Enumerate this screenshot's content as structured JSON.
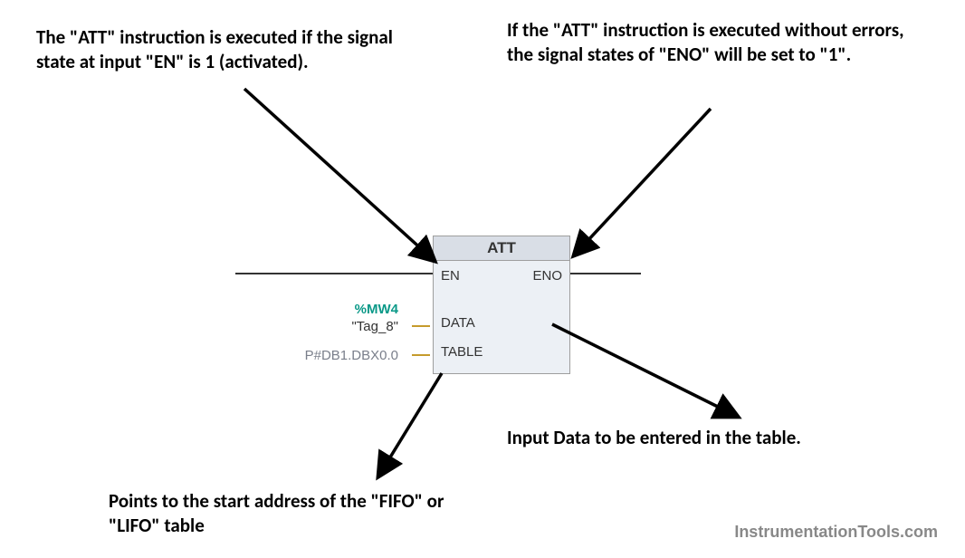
{
  "annotations": {
    "en_text": "The \"ATT\" instruction is executed if the signal state at input \"EN\" is 1 (activated).",
    "eno_text": "If the \"ATT\" instruction is executed without errors, the signal states of \"ENO\" will be set to \"1\".",
    "data_text": "Input Data to be entered in the table.",
    "table_text": "Points to the start address of the \"FIFO\" or \"LIFO\" table"
  },
  "block": {
    "title": "ATT",
    "pins": {
      "en": "EN",
      "eno": "ENO",
      "data": "DATA",
      "table": "TABLE"
    },
    "params": {
      "data_addr": "%MW4",
      "data_name": "\"Tag_8\"",
      "table_ptr": "P#DB1.DBX0.0"
    }
  },
  "watermark": "InstrumentationTools.com",
  "chart_data": {
    "type": "diagram",
    "instruction": "ATT",
    "inputs": [
      {
        "pin": "EN",
        "description": "Enable input. Instruction executes when signal state is 1."
      },
      {
        "pin": "DATA",
        "operand": "%MW4 (\"Tag_8\")",
        "description": "Input data to be entered in the table."
      },
      {
        "pin": "TABLE",
        "operand": "P#DB1.DBX0.0",
        "description": "Points to the start address of the FIFO or LIFO table."
      }
    ],
    "outputs": [
      {
        "pin": "ENO",
        "description": "Set to 1 if instruction executed without errors."
      }
    ]
  }
}
